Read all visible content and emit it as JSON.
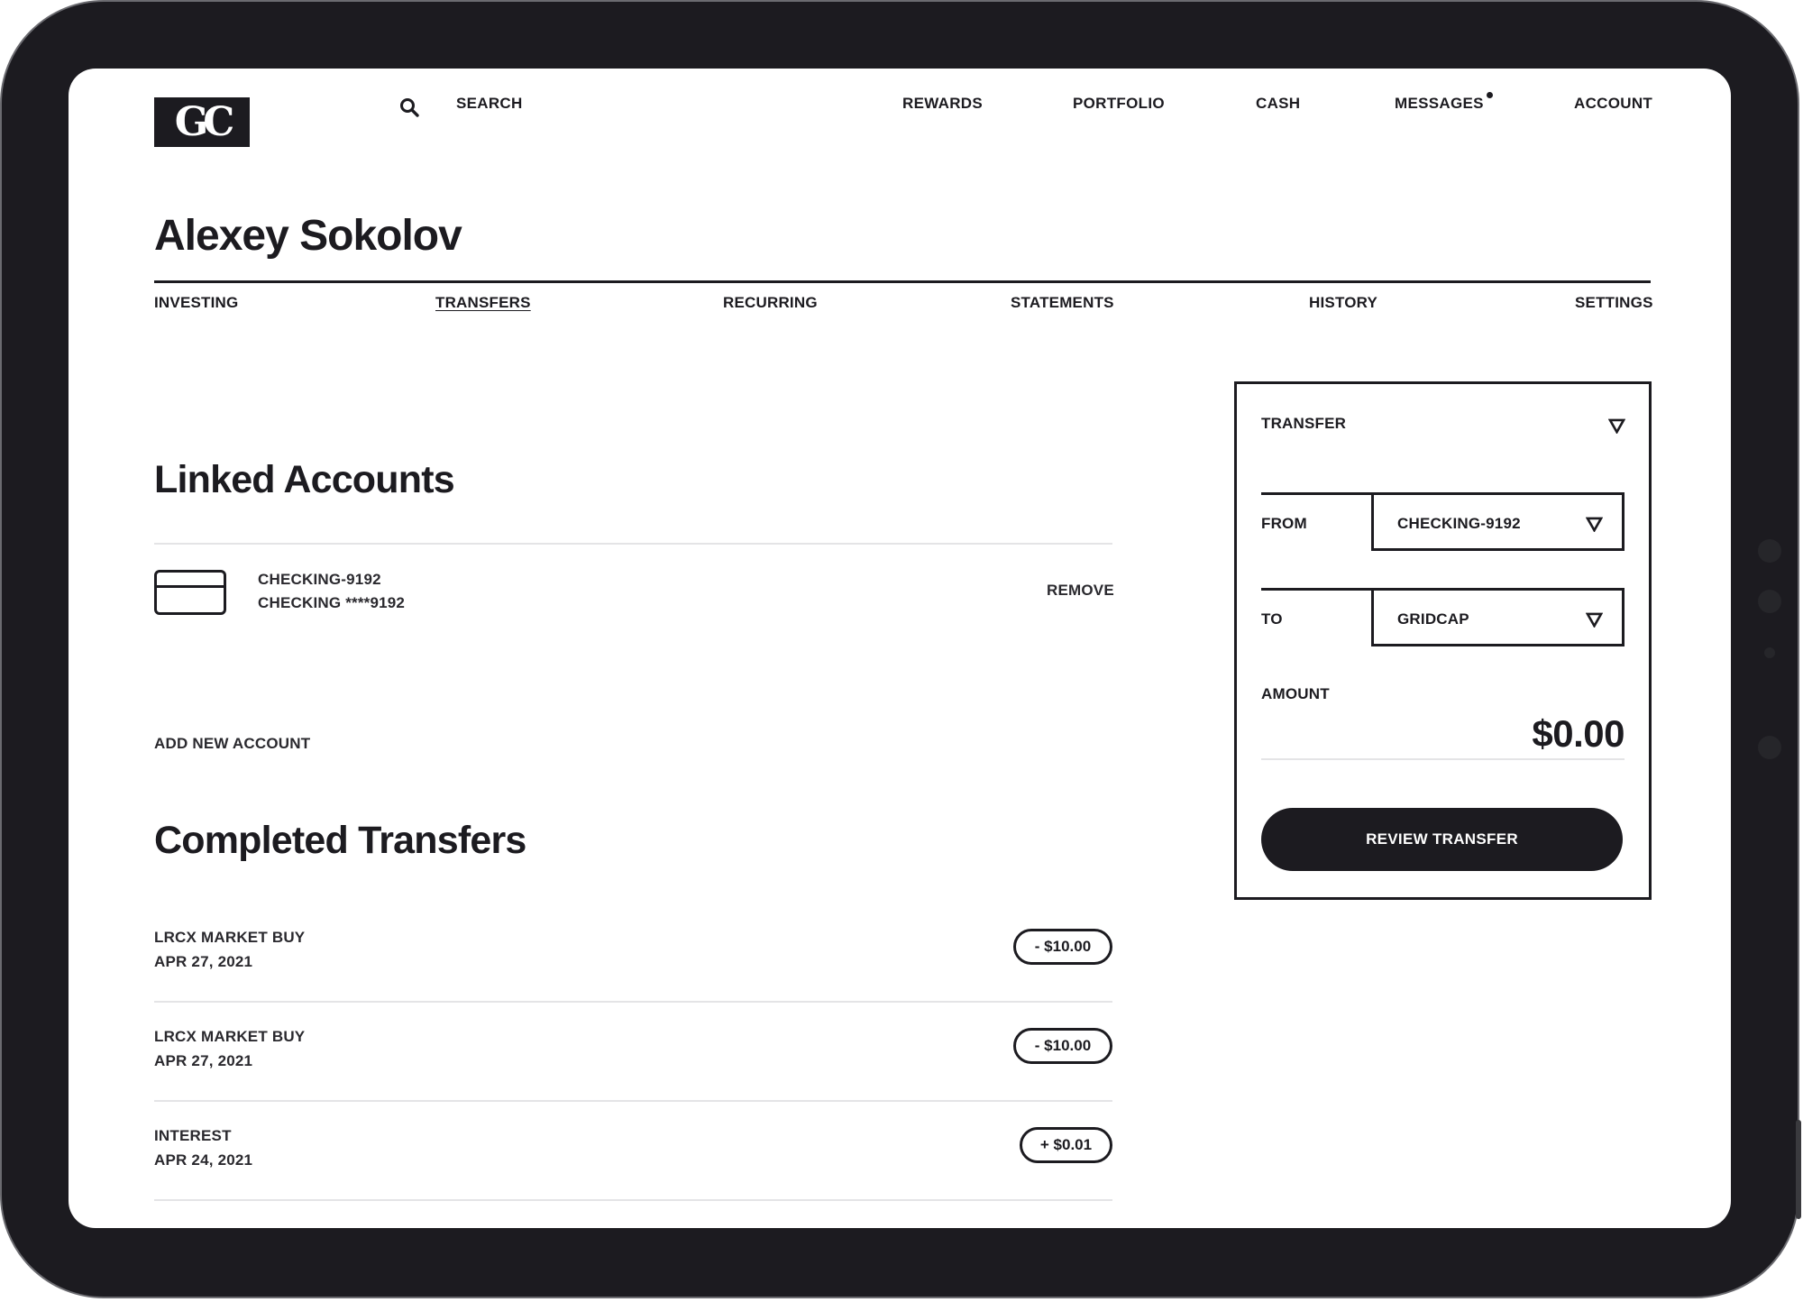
{
  "logo": {
    "text": "GC"
  },
  "header": {
    "search_label": "SEARCH",
    "nav": [
      {
        "label": "REWARDS"
      },
      {
        "label": "PORTFOLIO"
      },
      {
        "label": "CASH"
      },
      {
        "label": "MESSAGES",
        "has_unread": true
      },
      {
        "label": "ACCOUNT"
      }
    ]
  },
  "user": {
    "name": "Alexey Sokolov"
  },
  "tabs": [
    {
      "label": "INVESTING"
    },
    {
      "label": "TRANSFERS",
      "active": true
    },
    {
      "label": "RECURRING"
    },
    {
      "label": "STATEMENTS"
    },
    {
      "label": "HISTORY"
    },
    {
      "label": "SETTINGS"
    }
  ],
  "linked_accounts": {
    "title": "Linked Accounts",
    "accounts": [
      {
        "name": "CHECKING-9192",
        "detail": "CHECKING ****9192",
        "remove_label": "REMOVE"
      }
    ],
    "add_label": "ADD NEW ACCOUNT"
  },
  "completed_transfers": {
    "title": "Completed Transfers",
    "items": [
      {
        "label": "LRCX MARKET BUY",
        "date": "APR 27, 2021",
        "amount": "- $10.00"
      },
      {
        "label": "LRCX MARKET BUY",
        "date": "APR 27, 2021",
        "amount": "- $10.00"
      },
      {
        "label": "INTEREST",
        "date": "APR 24, 2021",
        "amount": "+ $0.01"
      }
    ]
  },
  "transfer_panel": {
    "type_label": "TRANSFER",
    "from_label": "FROM",
    "from_value": "CHECKING-9192",
    "to_label": "TO",
    "to_value": "GRIDCAP",
    "amount_label": "AMOUNT",
    "amount_value": "$0.00",
    "review_label": "REVIEW TRANSFER"
  },
  "colors": {
    "ink": "#1c1b20",
    "bezel": "#1c1b20",
    "divider": "#e4e4e6"
  },
  "icons": [
    "search-icon",
    "card-icon",
    "chevron-down-icon",
    "unread-dot-icon"
  ]
}
